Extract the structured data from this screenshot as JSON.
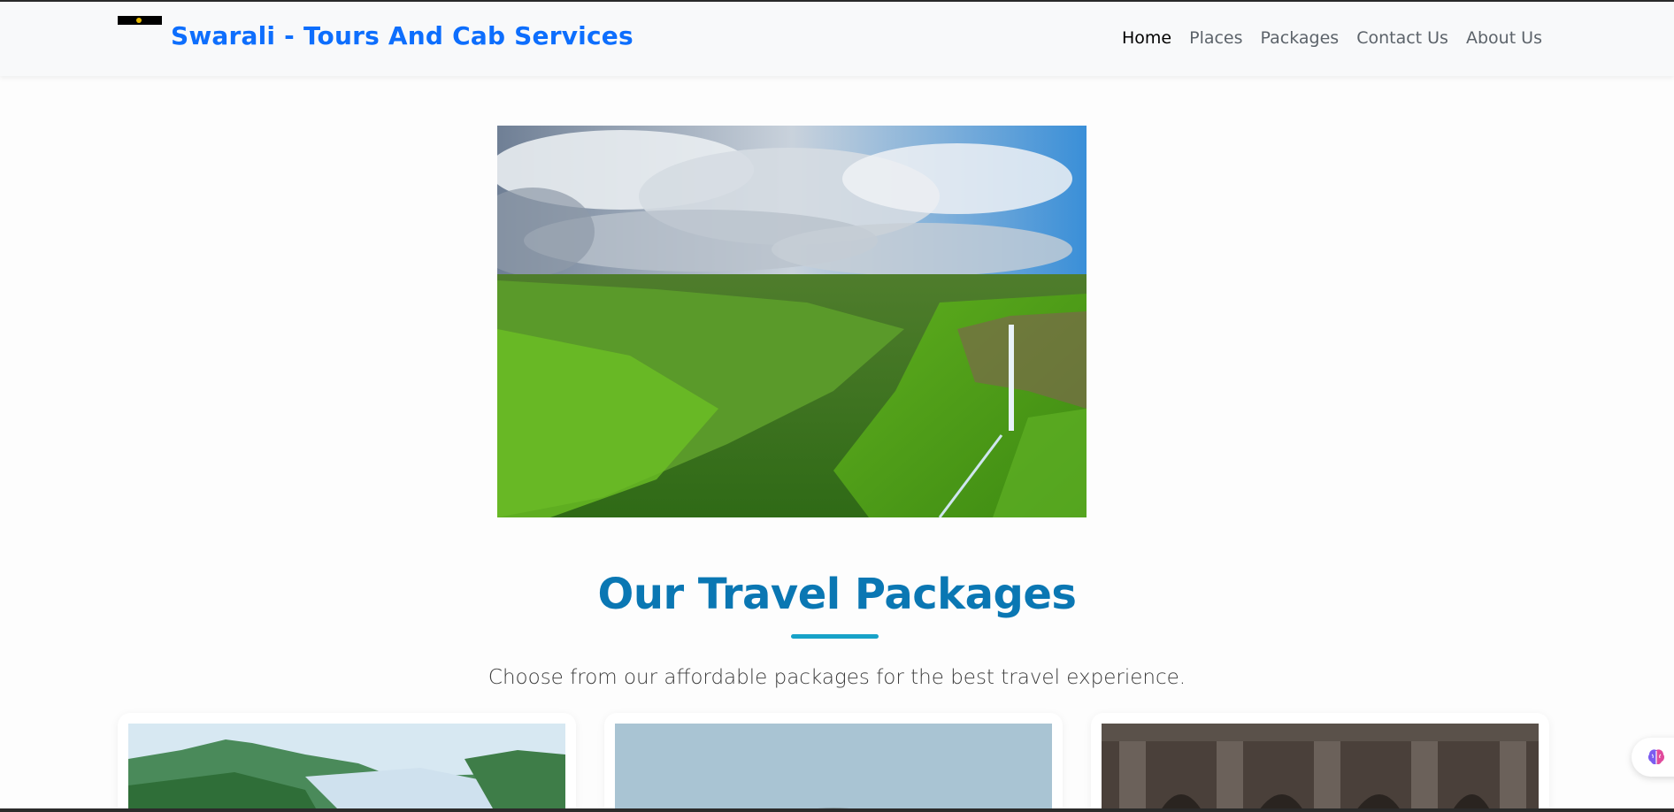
{
  "navbar": {
    "brand": "Swarali - Tours And Cab Services",
    "links": [
      {
        "label": "Home",
        "active": true
      },
      {
        "label": "Places",
        "active": false
      },
      {
        "label": "Packages",
        "active": false
      },
      {
        "label": "Contact Us",
        "active": false
      },
      {
        "label": "About Us",
        "active": false
      }
    ]
  },
  "hero": {
    "image": "mountain-waterfall-landscape"
  },
  "packages": {
    "title": "Our Travel Packages",
    "subtitle": "Choose from our affordable packages for the best travel experience.",
    "cards": [
      {
        "image": "hills-lake-landscape"
      },
      {
        "image": "misty-hill-landscape"
      },
      {
        "image": "stone-temple-carvings"
      }
    ]
  },
  "floating_widget": {
    "icon": "brain-icon"
  },
  "colors": {
    "brand": "#0d6efd",
    "section_title": "#0a77b3",
    "accent_underline": "#17a2c8",
    "navbar_bg": "#f8f9fa"
  }
}
